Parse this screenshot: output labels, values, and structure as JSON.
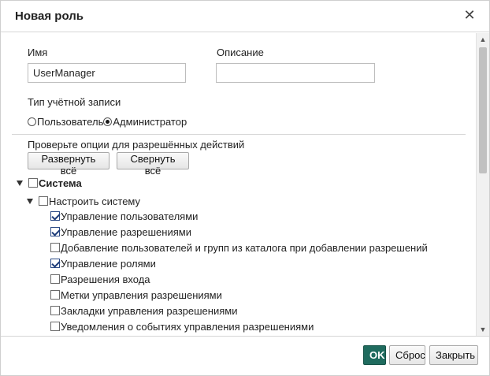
{
  "dialog": {
    "title": "Новая роль",
    "close_icon": "close-icon"
  },
  "form": {
    "name_label": "Имя",
    "name_value": "UserManager",
    "description_label": "Описание",
    "description_value": "",
    "account_type_label": "Тип учётной записи",
    "account_types": [
      {
        "label": "Пользователь",
        "selected": false
      },
      {
        "label": "Администратор",
        "selected": true
      }
    ],
    "permissions_hint": "Проверьте опции для разрешённых действий",
    "expand_all": "Развернуть всё",
    "collapse_all": "Свернуть всё"
  },
  "tree": {
    "root": {
      "label": "Система",
      "checked": false,
      "expanded": true
    },
    "group": {
      "label": "Настроить систему",
      "checked": false,
      "expanded": true
    },
    "items": [
      {
        "label": "Управление пользователями",
        "checked": true
      },
      {
        "label": "Управление разрешениями",
        "checked": true
      },
      {
        "label": "Добавление пользователей и групп из каталога при добавлении разрешений",
        "checked": false
      },
      {
        "label": "Управление ролями",
        "checked": true
      },
      {
        "label": "Разрешения входа",
        "checked": false
      },
      {
        "label": "Метки управления разрешениями",
        "checked": false
      },
      {
        "label": "Закладки управления разрешениями",
        "checked": false
      },
      {
        "label": "Уведомления о событиях управления разрешениями",
        "checked": false
      }
    ]
  },
  "footer": {
    "ok": "OK",
    "reset": "Сброс",
    "close": "Закрыть"
  },
  "colors": {
    "primary_button": "#1f6b5e",
    "checkbox_checked": "#1b3a78"
  }
}
